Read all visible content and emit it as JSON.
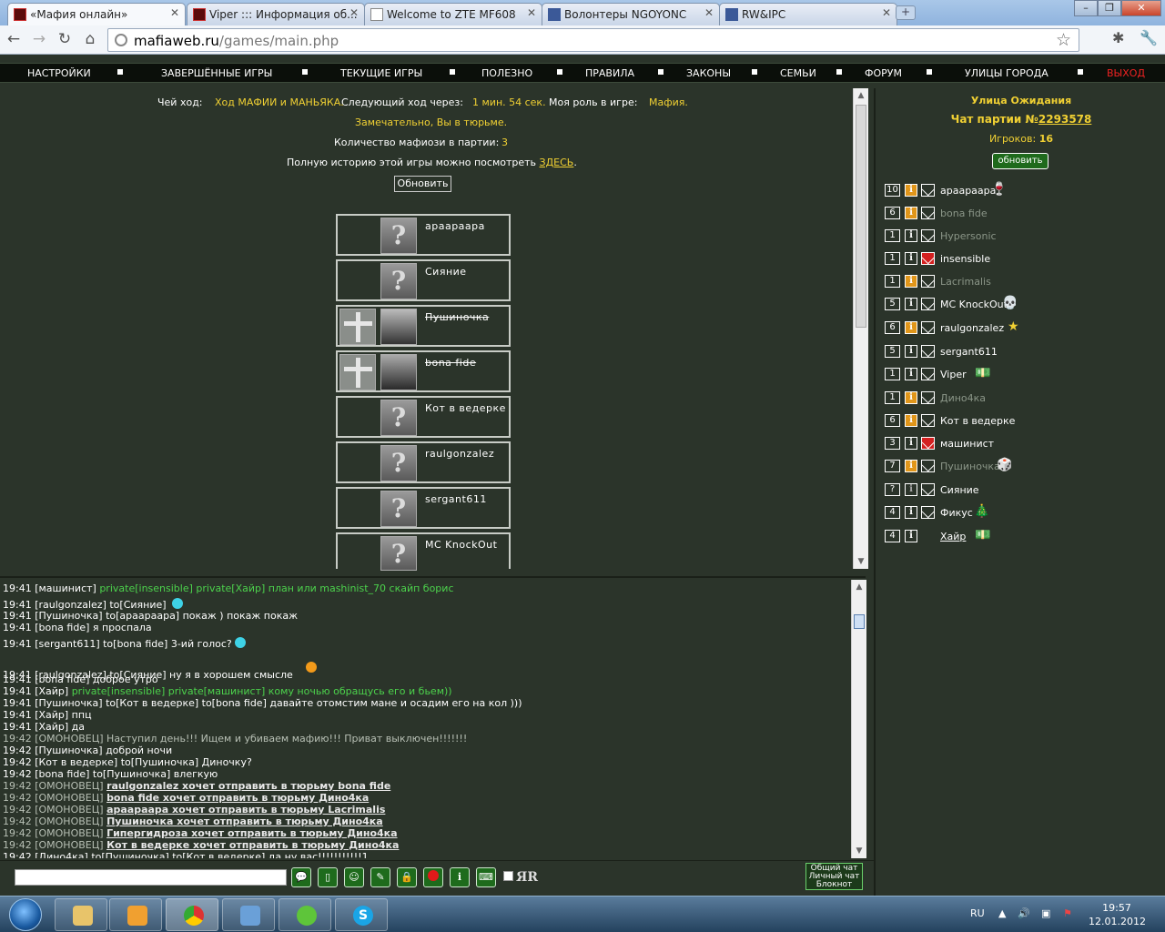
{
  "tabs": [
    {
      "label": "«Мафия онлайн»"
    },
    {
      "label": "Viper ::: Информация об..."
    },
    {
      "label": "Welcome to ZTE MF608"
    },
    {
      "label": "Волонтеры NGOYONC"
    },
    {
      "label": "RW&IPC"
    }
  ],
  "address": {
    "host": "mafiaweb.ru",
    "path": "/games/main.php"
  },
  "menu": [
    "НАСТРОЙКИ",
    "ЗАВЕРШЁННЫЕ ИГРЫ",
    "ТЕКУЩИЕ ИГРЫ",
    "ПОЛЕЗНО",
    "ПРАВИЛА",
    "ЗАКОНЫ",
    "СЕМЬИ",
    "ФОРУМ",
    "УЛИЦЫ ГОРОДА",
    "ВЫХОД"
  ],
  "status": {
    "turn_label": "Чей ход:",
    "turn_value": "Ход МАФИИ и МАНЬЯКА.",
    "next_label": "Следующий ход через:",
    "next_value": "1 мин. 54 сек.",
    "role_label": "Моя роль в игре:",
    "role_value": "Мафия.",
    "jail_msg": "Замечательно, Вы в тюрьме.",
    "mafia_count_label": "Количество мафиози в партии:",
    "mafia_count_value": "3",
    "history_text": "Полную историю этой игры можно посмотреть",
    "history_link": "ЗДЕСЬ",
    "history_dot": ".",
    "refresh_label": "Обновить"
  },
  "players": [
    {
      "name": "арааpаара",
      "dead": false
    },
    {
      "name": "Сияние",
      "dead": false
    },
    {
      "name": "Пушиночка",
      "dead": true
    },
    {
      "name": "bona fide",
      "dead": true
    },
    {
      "name": "Кот в ведерке",
      "dead": false
    },
    {
      "name": "raulgonzalez",
      "dead": false
    },
    {
      "name": "sergant611",
      "dead": false
    },
    {
      "name": "MC KnockOut",
      "dead": false
    }
  ],
  "sidebar": {
    "street": "Улица Ожидания",
    "chat_label": "Чат партии №",
    "chat_number": "2293578",
    "players_label": "Игроков:",
    "players_count": "16",
    "refresh_label": "обновить",
    "users": [
      {
        "level": "10",
        "name": "араарaара"
      },
      {
        "level": "6",
        "name": "bona fide"
      },
      {
        "level": "1",
        "name": "Hypersonic"
      },
      {
        "level": "1",
        "name": "insensible"
      },
      {
        "level": "1",
        "name": "Lacrimalis"
      },
      {
        "level": "5",
        "name": "MC KnockOut"
      },
      {
        "level": "6",
        "name": "raulgonzalez"
      },
      {
        "level": "5",
        "name": "sergant611"
      },
      {
        "level": "1",
        "name": "Viper"
      },
      {
        "level": "1",
        "name": "Дино4ка"
      },
      {
        "level": "6",
        "name": "Кот в ведерке"
      },
      {
        "level": "3",
        "name": "машинист"
      },
      {
        "level": "7",
        "name": "Пушиночка"
      },
      {
        "level": "?",
        "name": "Сияние"
      },
      {
        "level": "4",
        "name": "Фикус"
      },
      {
        "level": "4",
        "name": "Хайр"
      }
    ]
  },
  "chat": [
    [
      "19:41 [машинист] ",
      "private[insensible] private[Хайр] план или mashinist_70 скайп борис",
      ""
    ],
    [
      "19:41 [raulgonzalez] to[Сияние] ",
      "",
      ""
    ],
    [
      "19:41 [Пушиночка] to[араарaара] покаж ) покаж покаж",
      "",
      ""
    ],
    [
      "19:41 [bona fide] я проспала",
      "",
      ""
    ],
    [
      "19:41 [sergant611] to[bona fide] 3-ий голос?",
      "",
      ""
    ],
    [
      "19:41 [raulgonzalez] to[Сияние] ну я в хорошем смысле",
      "",
      ""
    ],
    [
      "19:41 [bona fide] доброе утро",
      "",
      ""
    ],
    [
      "19:41 [Хайр] ",
      "private[insensible] private[машинист] кому ночью обращусь его и бьем))",
      ""
    ],
    [
      "19:41 [Пушиночка] to[Кот в ведерке] to[bona fide] давайте отомстим мане и осадим его на кол )))",
      "",
      ""
    ],
    [
      "19:41 [Хайр] ппц",
      "",
      ""
    ],
    [
      "19:41 [Хайр] да",
      "",
      ""
    ],
    [
      "",
      "",
      "19:42 [ОМОНОВЕЦ] Наступил день!!! Ищем и убиваем мафию!!! Приват выключен!!!!!!!"
    ],
    [
      "19:42 [Пушиночка] доброй ночи",
      "",
      ""
    ],
    [
      "19:42 [Кот в ведерке] to[Пушиночка] Диночку?",
      "",
      ""
    ],
    [
      "19:42 [bona fide] to[Пушиночка] влегкую",
      "",
      ""
    ]
  ],
  "omon": [
    "raulgonzalez хочет отправить в тюрьму bona fide",
    "bona fide хочет отправить в тюрьму Дино4ка",
    "араарaара хочет отправить в тюрьму Lacrimalis",
    "Пушиночка хочет отправить в тюрьму Дино4ка",
    "Гипергидроза хочет отправить в тюрьму Дино4ка",
    "Кот в ведерке хочет отправить в тюрьму Дино4ка"
  ],
  "omon_prefix": "19:42 [ОМОНОВЕЦ] ",
  "last_line": "19:42 [Дино4ка] to[Пушиночка] to[Кот в ведерке] да ну вас!!!!!!!!!!!1",
  "input": {
    "yar_label": "ЯR",
    "mode_common": "Общий чат",
    "mode_private": "Личный чат",
    "mode_notes": "Блокнот"
  },
  "tray": {
    "lang": "RU",
    "time": "19:57",
    "date": "12.01.2012"
  }
}
